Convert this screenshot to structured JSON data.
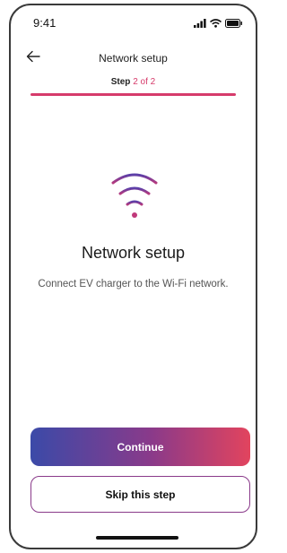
{
  "status_bar": {
    "time": "9:41",
    "icons": [
      "signal-icon",
      "wifi-icon",
      "battery-icon"
    ]
  },
  "header": {
    "back_icon": "arrow-left-icon",
    "title": "Network setup"
  },
  "progress": {
    "step_label": "Step",
    "step_value": "2 of 2",
    "fraction": 1.0,
    "accent_color": "#d63b6b"
  },
  "main": {
    "icon": "wifi-icon",
    "title": "Network setup",
    "description": "Connect EV charger to the Wi-Fi network."
  },
  "actions": {
    "continue_label": "Continue",
    "skip_label": "Skip this step"
  },
  "colors": {
    "gradient_start": "#3b4aa8",
    "gradient_mid": "#8a3a8a",
    "gradient_end": "#e2445e"
  }
}
